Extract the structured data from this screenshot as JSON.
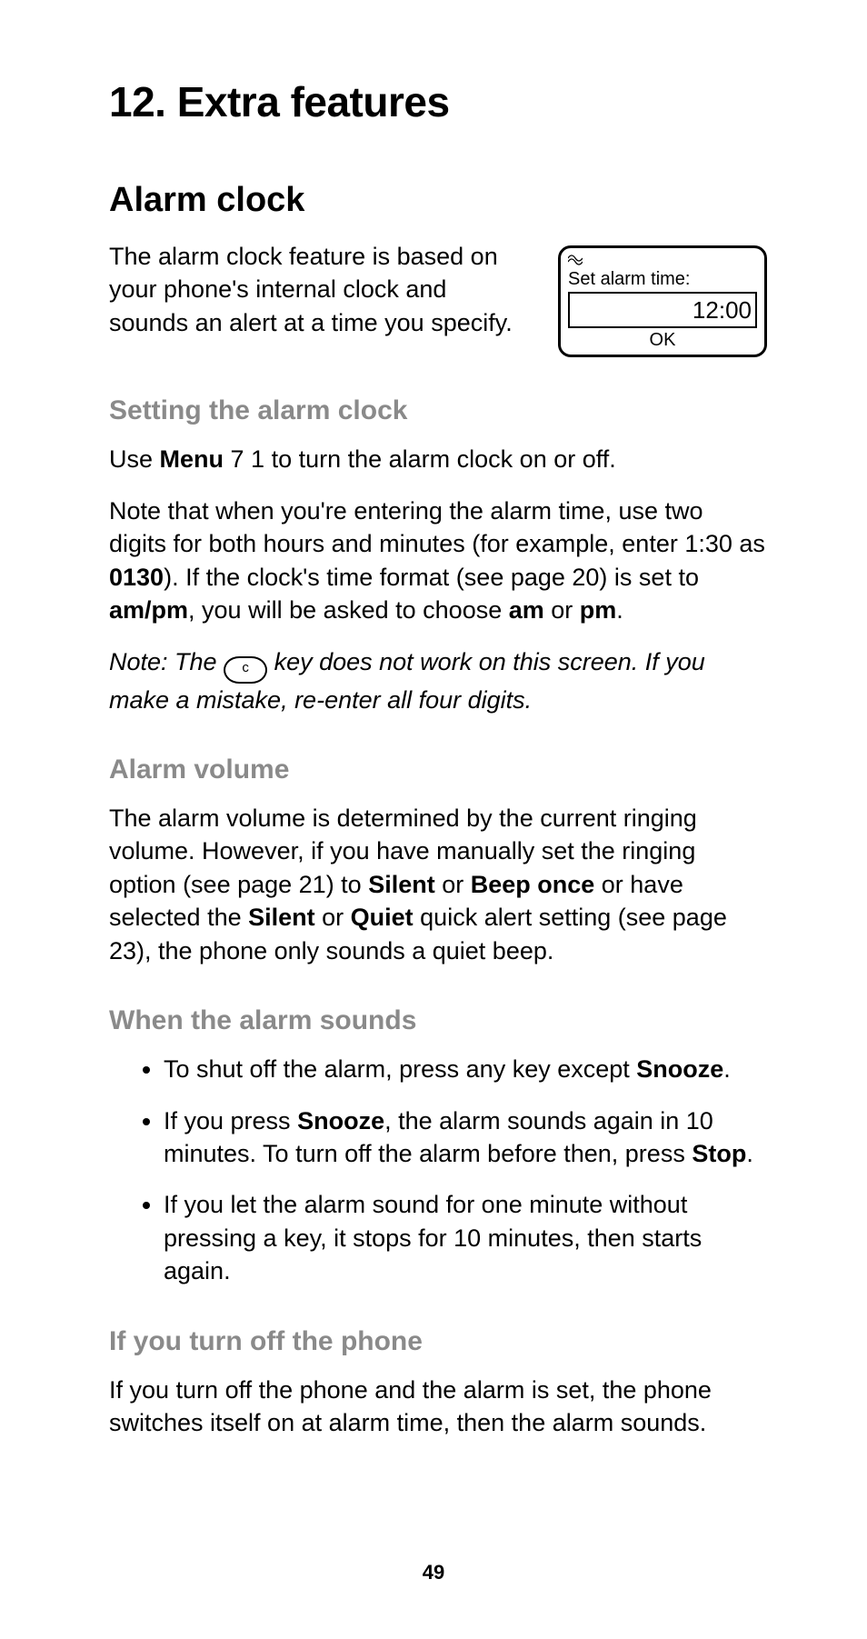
{
  "chapter_title": "12. Extra features",
  "section_title": "Alarm clock",
  "intro_paragraph": "The alarm clock feature is based on your phone's internal clock and sounds an alert at a time you specify.",
  "phone_screen": {
    "label": "Set alarm time:",
    "time_value": "12:00",
    "softkey": "OK"
  },
  "sub1": {
    "heading": "Setting the alarm clock",
    "p1_pre": "Use ",
    "p1_bold": "Menu",
    "p1_post": " 7 1 to turn the alarm clock on or off.",
    "p2_a": "Note that when you're entering the alarm time, use two digits for both hours and minutes (for example, enter 1:30 as ",
    "p2_b": "0130",
    "p2_c": "). If the clock's time format (see page 20) is set to ",
    "p2_d": "am/pm",
    "p2_e": ", you will be asked to choose ",
    "p2_f": "am",
    "p2_g": " or ",
    "p2_h": "pm",
    "p2_i": ".",
    "note_pre": "Note: The ",
    "note_key": "c",
    "note_post": " key does not work on this screen. If you make a mistake, re-enter all four digits."
  },
  "sub2": {
    "heading": "Alarm volume",
    "p_a": "The alarm volume is determined by the current ringing volume. However, if you have manually set the ringing option (see page 21) to ",
    "p_b": "Silent",
    "p_c": " or ",
    "p_d": "Beep once",
    "p_e": " or have selected the ",
    "p_f": "Silent",
    "p_g": " or ",
    "p_h": "Quiet",
    "p_i": " quick alert setting (see page 23), the phone only sounds a quiet beep."
  },
  "sub3": {
    "heading": "When the alarm sounds",
    "li1_a": "To shut off the alarm, press any key except ",
    "li1_b": "Snooze",
    "li1_c": ".",
    "li2_a": "If you press ",
    "li2_b": "Snooze",
    "li2_c": ", the alarm sounds again in 10 minutes. To turn off the alarm before then, press ",
    "li2_d": "Stop",
    "li2_e": ".",
    "li3": "If you let the alarm sound for one minute without pressing a key, it stops for 10 minutes, then starts again."
  },
  "sub4": {
    "heading": "If you turn off the phone",
    "p": "If you turn off the phone and the alarm is set, the phone switches itself on at alarm time, then the alarm sounds."
  },
  "page_number": "49"
}
